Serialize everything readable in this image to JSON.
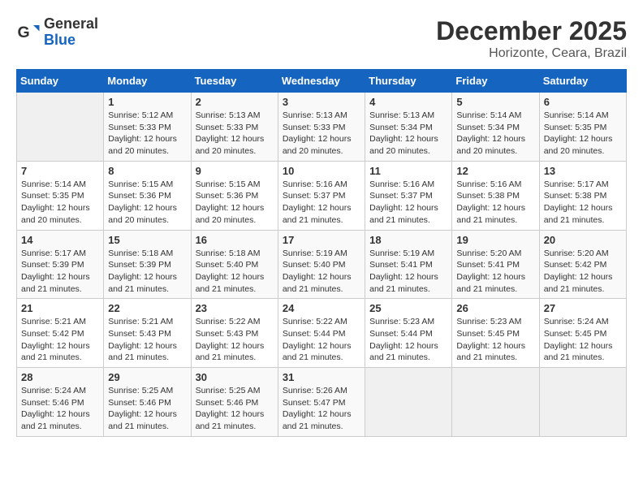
{
  "logo": {
    "general": "General",
    "blue": "Blue"
  },
  "header": {
    "month": "December 2025",
    "location": "Horizonte, Ceara, Brazil"
  },
  "weekdays": [
    "Sunday",
    "Monday",
    "Tuesday",
    "Wednesday",
    "Thursday",
    "Friday",
    "Saturday"
  ],
  "weeks": [
    [
      {
        "day": "",
        "info": ""
      },
      {
        "day": "1",
        "info": "Sunrise: 5:12 AM\nSunset: 5:33 PM\nDaylight: 12 hours\nand 20 minutes."
      },
      {
        "day": "2",
        "info": "Sunrise: 5:13 AM\nSunset: 5:33 PM\nDaylight: 12 hours\nand 20 minutes."
      },
      {
        "day": "3",
        "info": "Sunrise: 5:13 AM\nSunset: 5:33 PM\nDaylight: 12 hours\nand 20 minutes."
      },
      {
        "day": "4",
        "info": "Sunrise: 5:13 AM\nSunset: 5:34 PM\nDaylight: 12 hours\nand 20 minutes."
      },
      {
        "day": "5",
        "info": "Sunrise: 5:14 AM\nSunset: 5:34 PM\nDaylight: 12 hours\nand 20 minutes."
      },
      {
        "day": "6",
        "info": "Sunrise: 5:14 AM\nSunset: 5:35 PM\nDaylight: 12 hours\nand 20 minutes."
      }
    ],
    [
      {
        "day": "7",
        "info": "Sunrise: 5:14 AM\nSunset: 5:35 PM\nDaylight: 12 hours\nand 20 minutes."
      },
      {
        "day": "8",
        "info": "Sunrise: 5:15 AM\nSunset: 5:36 PM\nDaylight: 12 hours\nand 20 minutes."
      },
      {
        "day": "9",
        "info": "Sunrise: 5:15 AM\nSunset: 5:36 PM\nDaylight: 12 hours\nand 20 minutes."
      },
      {
        "day": "10",
        "info": "Sunrise: 5:16 AM\nSunset: 5:37 PM\nDaylight: 12 hours\nand 21 minutes."
      },
      {
        "day": "11",
        "info": "Sunrise: 5:16 AM\nSunset: 5:37 PM\nDaylight: 12 hours\nand 21 minutes."
      },
      {
        "day": "12",
        "info": "Sunrise: 5:16 AM\nSunset: 5:38 PM\nDaylight: 12 hours\nand 21 minutes."
      },
      {
        "day": "13",
        "info": "Sunrise: 5:17 AM\nSunset: 5:38 PM\nDaylight: 12 hours\nand 21 minutes."
      }
    ],
    [
      {
        "day": "14",
        "info": "Sunrise: 5:17 AM\nSunset: 5:39 PM\nDaylight: 12 hours\nand 21 minutes."
      },
      {
        "day": "15",
        "info": "Sunrise: 5:18 AM\nSunset: 5:39 PM\nDaylight: 12 hours\nand 21 minutes."
      },
      {
        "day": "16",
        "info": "Sunrise: 5:18 AM\nSunset: 5:40 PM\nDaylight: 12 hours\nand 21 minutes."
      },
      {
        "day": "17",
        "info": "Sunrise: 5:19 AM\nSunset: 5:40 PM\nDaylight: 12 hours\nand 21 minutes."
      },
      {
        "day": "18",
        "info": "Sunrise: 5:19 AM\nSunset: 5:41 PM\nDaylight: 12 hours\nand 21 minutes."
      },
      {
        "day": "19",
        "info": "Sunrise: 5:20 AM\nSunset: 5:41 PM\nDaylight: 12 hours\nand 21 minutes."
      },
      {
        "day": "20",
        "info": "Sunrise: 5:20 AM\nSunset: 5:42 PM\nDaylight: 12 hours\nand 21 minutes."
      }
    ],
    [
      {
        "day": "21",
        "info": "Sunrise: 5:21 AM\nSunset: 5:42 PM\nDaylight: 12 hours\nand 21 minutes."
      },
      {
        "day": "22",
        "info": "Sunrise: 5:21 AM\nSunset: 5:43 PM\nDaylight: 12 hours\nand 21 minutes."
      },
      {
        "day": "23",
        "info": "Sunrise: 5:22 AM\nSunset: 5:43 PM\nDaylight: 12 hours\nand 21 minutes."
      },
      {
        "day": "24",
        "info": "Sunrise: 5:22 AM\nSunset: 5:44 PM\nDaylight: 12 hours\nand 21 minutes."
      },
      {
        "day": "25",
        "info": "Sunrise: 5:23 AM\nSunset: 5:44 PM\nDaylight: 12 hours\nand 21 minutes."
      },
      {
        "day": "26",
        "info": "Sunrise: 5:23 AM\nSunset: 5:45 PM\nDaylight: 12 hours\nand 21 minutes."
      },
      {
        "day": "27",
        "info": "Sunrise: 5:24 AM\nSunset: 5:45 PM\nDaylight: 12 hours\nand 21 minutes."
      }
    ],
    [
      {
        "day": "28",
        "info": "Sunrise: 5:24 AM\nSunset: 5:46 PM\nDaylight: 12 hours\nand 21 minutes."
      },
      {
        "day": "29",
        "info": "Sunrise: 5:25 AM\nSunset: 5:46 PM\nDaylight: 12 hours\nand 21 minutes."
      },
      {
        "day": "30",
        "info": "Sunrise: 5:25 AM\nSunset: 5:46 PM\nDaylight: 12 hours\nand 21 minutes."
      },
      {
        "day": "31",
        "info": "Sunrise: 5:26 AM\nSunset: 5:47 PM\nDaylight: 12 hours\nand 21 minutes."
      },
      {
        "day": "",
        "info": ""
      },
      {
        "day": "",
        "info": ""
      },
      {
        "day": "",
        "info": ""
      }
    ]
  ]
}
